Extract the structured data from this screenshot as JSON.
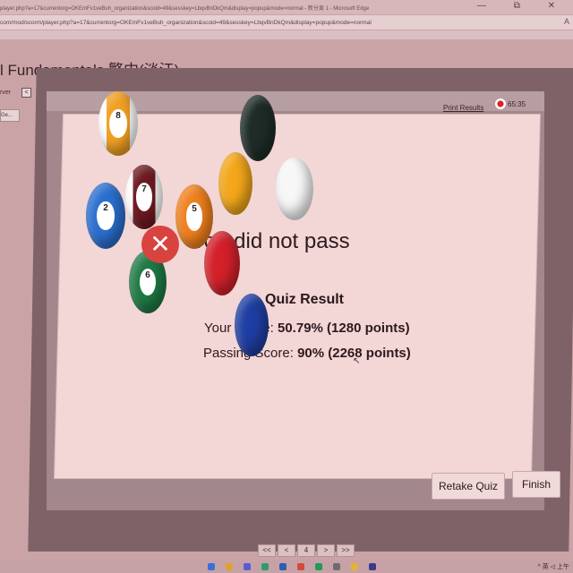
{
  "browser": {
    "title_url": "player.php?a=17&currentorg=OKEmFv1veBuh_organization&scoid=49&sesskey=LbqvBnDkQm&display=popup&mode=normal - 新分頁 1 - Microsoft Edge",
    "address_url": "com/mod/scorm/player.php?a=17&currentorg=OKEmFv1veBuh_organization&scoid=49&sesskey=LbqvBnDkQm&display=popup&mode=normal",
    "controls": "— ⧉ ✕"
  },
  "page": {
    "heading": "l Fundamentals 繁中(淡江)",
    "server_label": "rver",
    "collapse_label": "<",
    "go_label": "Ge..."
  },
  "player": {
    "print_results": "Print Results",
    "timer": "65:35"
  },
  "result": {
    "status_text": "You did not pass",
    "title": "Quiz Result",
    "your_score_label": "Your Score:",
    "your_score_value": "50.79% (1280 points)",
    "passing_label": "Passing Score:",
    "passing_value": "90% (2268 points)"
  },
  "buttons": {
    "retake": "Retake Quiz",
    "finish": "Finish"
  },
  "pager": {
    "first": "<<",
    "prev": "<",
    "page": "4",
    "next": ">",
    "last": ">>"
  },
  "taskbar": {
    "tray_text": "^ 英 ◁ 上午"
  },
  "colors": {
    "fail_badge": "#d8433f",
    "card_bg": "#f3d6d6",
    "player_frame": "#7e6267"
  }
}
